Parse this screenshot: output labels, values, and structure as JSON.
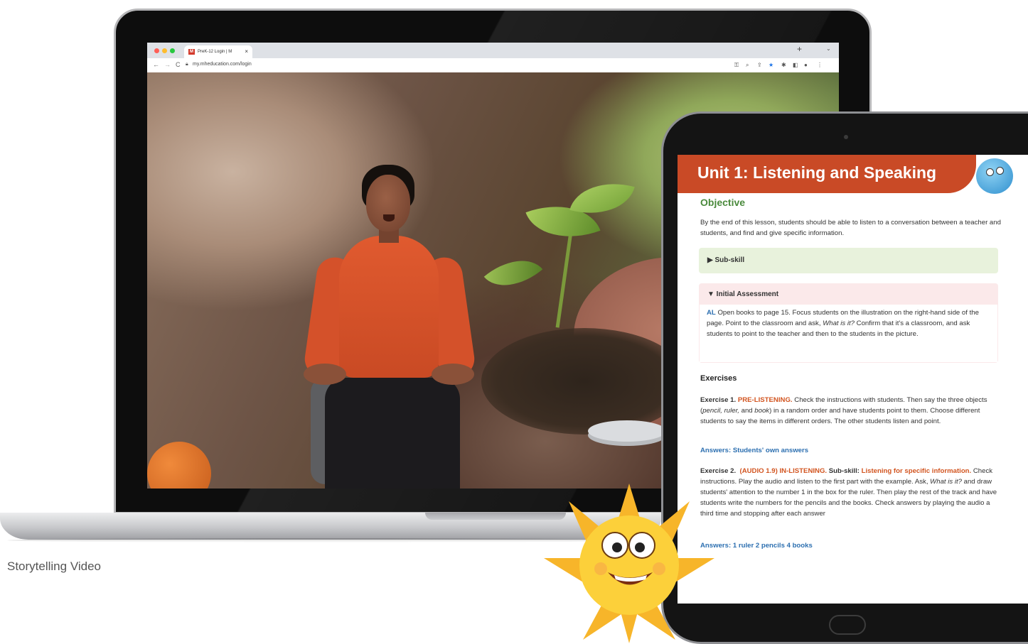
{
  "browser": {
    "tab_title": "PreK-12 Login | M",
    "favicon_letter": "M",
    "close_glyph": "×",
    "new_tab_glyph": "+",
    "menu_glyph": "⌄",
    "url": "my.mheducation.com/login",
    "nav_back": "←",
    "nav_forward": "→",
    "nav_reload": "C"
  },
  "caption": "Storytelling Video",
  "tablet": {
    "unit_title": "Unit 1: Listening and Speaking",
    "objective_heading": "Objective",
    "objective_text": "By the end of this lesson, students should be able to listen to a conversation between a teacher and students, and find and give specific information.",
    "subskill_label": "▶  Sub-skill",
    "assessment_label": "▼  Initial Assessment",
    "assessment_tag": "AL",
    "assessment_text_1": " Open books to page 15. Focus students on the illustration on the right-hand side of the page. Point to the classroom and ask, ",
    "assessment_italic_1": "What is it?",
    "assessment_text_2": " Confirm that it's a classroom, and ask students to point to the teacher and then to the students in the picture.",
    "exercises_heading": "Exercises",
    "ex1_label": "Exercise 1.",
    "ex1_tag": "PRE-LISTENING.",
    "ex1_text_1": " Check the instructions with students. Then say the three objects (",
    "ex1_italic": "pencil, ruler,",
    "ex1_text_2": " and ",
    "ex1_italic_2": "book",
    "ex1_text_3": ") in a random order and have students point to them. Choose different students to say the items in different orders. The other students listen and point.",
    "ex1_answers": "Answers: Students' own answers",
    "ex2_label": "Exercise 2.",
    "ex2_tag": "(AUDIO 1.9) IN-LISTENING.",
    "ex2_subskill_label": "Sub-skill:",
    "ex2_subskill": "Listening for specific information.",
    "ex2_text_1": " Check instructions. Play the audio and listen to the first part with the example. Ask, ",
    "ex2_italic": "What is it?",
    "ex2_text_2": " and draw students' attention to the number 1 in the box for the ruler. Then play the rest of the track and have students write the numbers for the pencils and the books. Check answers by playing the audio a third time and stopping after each answer",
    "ex2_answers": "Answers: 1 ruler 2 pencils 4 books"
  },
  "colors": {
    "unit_banner": "#c94a26",
    "objective_green": "#4a8a3c",
    "answer_blue": "#2c6fb0",
    "tag_orange": "#d2541f",
    "subskill_bg": "#e8f2dc",
    "assessment_bg": "#fbe9ea"
  },
  "icons": [
    "key-icon",
    "search-icon",
    "share-icon",
    "star-icon",
    "extensions-icon",
    "sidebar-icon",
    "profile-icon",
    "more-icon",
    "lock-icon"
  ]
}
